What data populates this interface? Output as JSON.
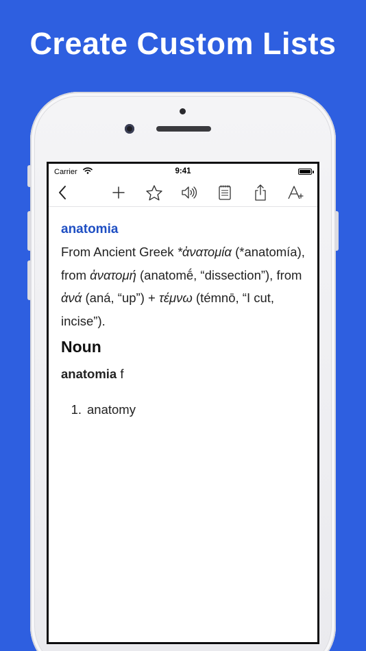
{
  "headline": "Create Custom Lists",
  "status_bar": {
    "carrier": "Carrier",
    "time": "9:41",
    "battery_level": 1.0
  },
  "toolbar": {
    "icons": [
      "chevron-left-icon",
      "plus-icon",
      "star-icon",
      "speaker-icon",
      "notepad-icon",
      "share-icon",
      "text-size-icon"
    ]
  },
  "entry": {
    "headword": "anatomia",
    "etymology": {
      "p1": "From Ancient Greek ",
      "g1": "*ἀνατομία",
      "p2": " (*anatomía), from ",
      "g2": "ἀνατομή",
      "p3": " (anatomḗ, “dissection”), from ",
      "g3": "ἀνά",
      "p4": " (aná, “up”) + ",
      "g4": "τέμνω",
      "p5": " (témnō, “I cut, incise”)."
    },
    "part_of_speech": "Noun",
    "form": {
      "word": "anatomia",
      "gender": " f"
    },
    "senses": [
      {
        "number": "1.",
        "text": "anatomy"
      }
    ]
  },
  "colors": {
    "background": "#2e5fe0",
    "headword": "#1f4fc3"
  }
}
